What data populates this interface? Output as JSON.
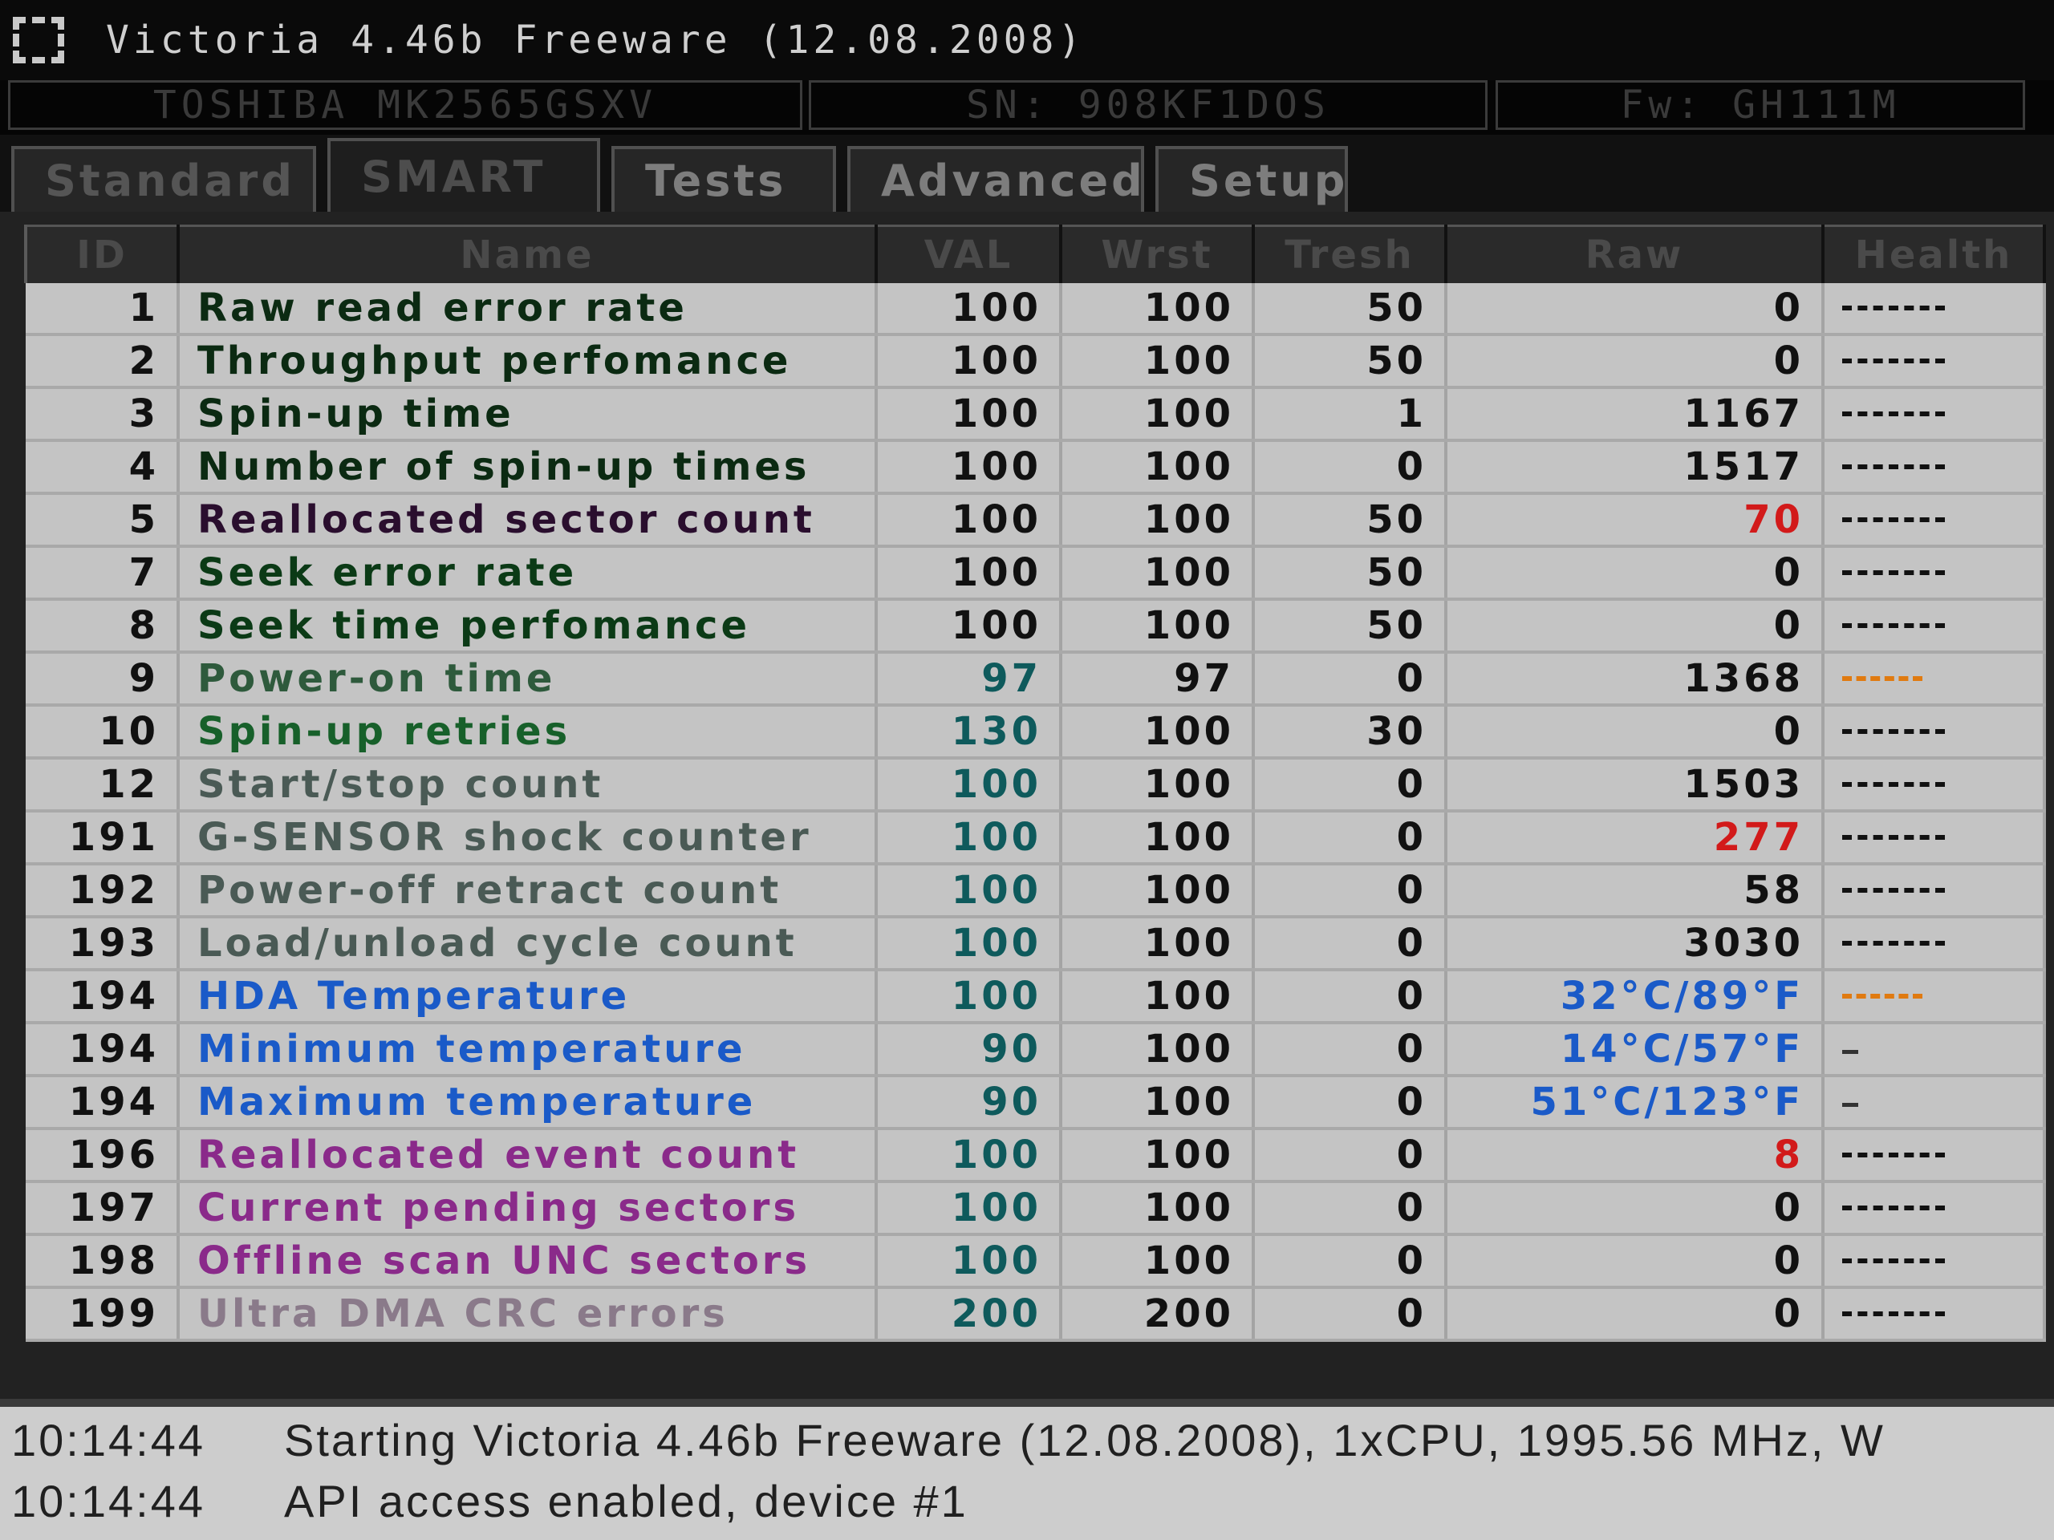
{
  "window": {
    "title": "Victoria 4.46b Freeware (12.08.2008)",
    "drive_model": "TOSHIBA MK2565GSXV",
    "serial": "SN: 908KF1DOS",
    "firmware": "Fw: GH111M"
  },
  "tabs": [
    "Standard",
    "SMART",
    "Tests",
    "Advanced",
    "Setup"
  ],
  "table": {
    "headers": [
      "ID",
      "Name",
      "VAL",
      "Wrst",
      "Tresh",
      "Raw",
      "Health"
    ],
    "rows": [
      {
        "id": "1",
        "name": "Raw read error rate",
        "val": "100",
        "wrst": "100",
        "tresh": "50",
        "raw": "0",
        "health": "good",
        "name_color": "#0b2a12",
        "val_color": "#111",
        "raw_color": "#111"
      },
      {
        "id": "2",
        "name": "Throughput perfomance",
        "val": "100",
        "wrst": "100",
        "tresh": "50",
        "raw": "0",
        "health": "good",
        "name_color": "#0b2a12",
        "val_color": "#111",
        "raw_color": "#111"
      },
      {
        "id": "3",
        "name": "Spin-up time",
        "val": "100",
        "wrst": "100",
        "tresh": "1",
        "raw": "1167",
        "health": "good",
        "name_color": "#0b2a12",
        "val_color": "#111",
        "raw_color": "#111"
      },
      {
        "id": "4",
        "name": "Number of spin-up times",
        "val": "100",
        "wrst": "100",
        "tresh": "0",
        "raw": "1517",
        "health": "good",
        "name_color": "#0b2a12",
        "val_color": "#111",
        "raw_color": "#111"
      },
      {
        "id": "5",
        "name": "Reallocated sector count",
        "val": "100",
        "wrst": "100",
        "tresh": "50",
        "raw": "70",
        "health": "good",
        "name_color": "#2a0e2e",
        "val_color": "#111",
        "raw_color": "#d21a1a"
      },
      {
        "id": "7",
        "name": "Seek error rate",
        "val": "100",
        "wrst": "100",
        "tresh": "50",
        "raw": "0",
        "health": "good",
        "name_color": "#0b3a16",
        "val_color": "#111",
        "raw_color": "#111"
      },
      {
        "id": "8",
        "name": "Seek time perfomance",
        "val": "100",
        "wrst": "100",
        "tresh": "50",
        "raw": "0",
        "health": "good",
        "name_color": "#0b3a16",
        "val_color": "#111",
        "raw_color": "#111"
      },
      {
        "id": "9",
        "name": "Power-on time",
        "val": "97",
        "wrst": "97",
        "tresh": "0",
        "raw": "1368",
        "health": "warn",
        "name_color": "#2e5a3c",
        "val_color": "#0e5a5c",
        "raw_color": "#111"
      },
      {
        "id": "10",
        "name": "Spin-up retries",
        "val": "130",
        "wrst": "100",
        "tresh": "30",
        "raw": "0",
        "health": "good",
        "name_color": "#17602a",
        "val_color": "#0e5a5c",
        "raw_color": "#111"
      },
      {
        "id": "12",
        "name": "Start/stop count",
        "val": "100",
        "wrst": "100",
        "tresh": "0",
        "raw": "1503",
        "health": "good",
        "name_color": "#4a5a55",
        "val_color": "#0e5a5c",
        "raw_color": "#111"
      },
      {
        "id": "191",
        "name": "G-SENSOR shock counter",
        "val": "100",
        "wrst": "100",
        "tresh": "0",
        "raw": "277",
        "health": "good",
        "name_color": "#4a5a55",
        "val_color": "#0e5a5c",
        "raw_color": "#d21a1a"
      },
      {
        "id": "192",
        "name": "Power-off retract count",
        "val": "100",
        "wrst": "100",
        "tresh": "0",
        "raw": "58",
        "health": "good",
        "name_color": "#4a5a55",
        "val_color": "#0e5a5c",
        "raw_color": "#111"
      },
      {
        "id": "193",
        "name": "Load/unload cycle count",
        "val": "100",
        "wrst": "100",
        "tresh": "0",
        "raw": "3030",
        "health": "good",
        "name_color": "#4a5a55",
        "val_color": "#0e5a5c",
        "raw_color": "#111"
      },
      {
        "id": "194",
        "name": "HDA Temperature",
        "val": "100",
        "wrst": "100",
        "tresh": "0",
        "raw": "32°C/89°F",
        "health": "warn",
        "name_color": "#1a5ac8",
        "val_color": "#0e5a5c",
        "raw_color": "#1a5ac8"
      },
      {
        "id": "194",
        "name": "Minimum temperature",
        "val": "90",
        "wrst": "100",
        "tresh": "0",
        "raw": "14°C/57°F",
        "health": "none",
        "name_color": "#1a5ac8",
        "val_color": "#0e5a5c",
        "raw_color": "#1a5ac8"
      },
      {
        "id": "194",
        "name": "Maximum temperature",
        "val": "90",
        "wrst": "100",
        "tresh": "0",
        "raw": "51°C/123°F",
        "health": "none",
        "name_color": "#1a5ac8",
        "val_color": "#0e5a5c",
        "raw_color": "#1a5ac8"
      },
      {
        "id": "196",
        "name": "Reallocated event count",
        "val": "100",
        "wrst": "100",
        "tresh": "0",
        "raw": "8",
        "health": "good",
        "name_color": "#8a2a8a",
        "val_color": "#0e5a5c",
        "raw_color": "#d21a1a"
      },
      {
        "id": "197",
        "name": "Current pending sectors",
        "val": "100",
        "wrst": "100",
        "tresh": "0",
        "raw": "0",
        "health": "good",
        "name_color": "#8a2a8a",
        "val_color": "#0e5a5c",
        "raw_color": "#111"
      },
      {
        "id": "198",
        "name": "Offline scan UNC sectors",
        "val": "100",
        "wrst": "100",
        "tresh": "0",
        "raw": "0",
        "health": "good",
        "name_color": "#8a2a8a",
        "val_color": "#0e5a5c",
        "raw_color": "#111"
      },
      {
        "id": "199",
        "name": "Ultra DMA CRC errors",
        "val": "200",
        "wrst": "200",
        "tresh": "0",
        "raw": "0",
        "health": "good",
        "name_color": "#8a7a8a",
        "val_color": "#0e5a5c",
        "raw_color": "#111"
      }
    ]
  },
  "log": [
    {
      "time": "10:14:44",
      "message": "Starting Victoria 4.46b Freeware (12.08.2008), 1xCPU, 1995.56 MHz, W"
    },
    {
      "time": "10:14:44",
      "message": "API access enabled, device #1"
    }
  ]
}
